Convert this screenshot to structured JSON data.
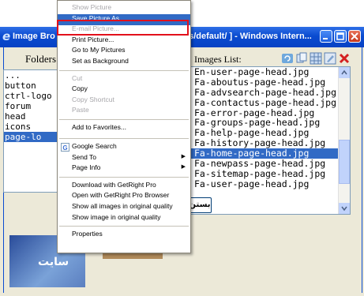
{
  "window": {
    "title_left": "Image Bro",
    "title_right": "es/default/ ] - Windows Intern...",
    "controls": [
      "minimize-icon",
      "maximize-icon",
      "close-icon"
    ]
  },
  "folders": {
    "label": "Folders",
    "items": [
      "...",
      "button",
      "ctrl-logo",
      "forum",
      "head",
      "icons",
      "page-lo"
    ],
    "selected_index": 6
  },
  "images": {
    "label": "Images List:",
    "toolbar_icons": [
      "refresh-icon",
      "copy-icon",
      "grid-icon",
      "edit-icon",
      "delete-icon"
    ],
    "items": [
      "En-user-page-head.jpg",
      "Fa-aboutus-page-head.jpg",
      "Fa-advsearch-page-head.jpg",
      "Fa-contactus-page-head.jpg",
      "Fa-error-page-head.jpg",
      "Fa-groups-page-head.jpg",
      "Fa-help-page-head.jpg",
      "Fa-history-page-head.jpg",
      "Fa-home-page-head.jpg",
      "Fa-newpass-page-head.jpg",
      "Fa-sitemap-page-head.jpg",
      "Fa-user-page-head.jpg"
    ],
    "selected_index": 8
  },
  "action_button": {
    "label": "بستن"
  },
  "preview": {
    "text": "سایت"
  },
  "context_menu": {
    "items": [
      {
        "label": "Show Picture",
        "disabled": true
      },
      {
        "label": "Save Picture As...",
        "highlighted": true
      },
      {
        "label": "E-mail Picture...",
        "disabled": true
      },
      {
        "label": "Print Picture..."
      },
      {
        "label": "Go to My Pictures"
      },
      {
        "label": "Set as Background"
      },
      {
        "separator": true
      },
      {
        "label": "Cut",
        "disabled": true
      },
      {
        "label": "Copy"
      },
      {
        "label": "Copy Shortcut",
        "disabled": true
      },
      {
        "label": "Paste",
        "disabled": true
      },
      {
        "separator": true
      },
      {
        "label": "Add to Favorites..."
      },
      {
        "separator": true
      },
      {
        "label": "Google Search",
        "icon": "google-icon"
      },
      {
        "label": "Send To",
        "submenu": true
      },
      {
        "label": "Page Info",
        "submenu": true
      },
      {
        "separator": true
      },
      {
        "label": "Download with GetRight Pro"
      },
      {
        "label": "Open with GetRight Pro Browser"
      },
      {
        "label": "Show all images in original quality"
      },
      {
        "label": "Show image in original quality"
      },
      {
        "separator": true
      },
      {
        "label": "Properties"
      }
    ],
    "highlight_color": "#e3101b"
  },
  "colors": {
    "selection": "#316ac5",
    "titlebar": "#0a4bd0"
  }
}
